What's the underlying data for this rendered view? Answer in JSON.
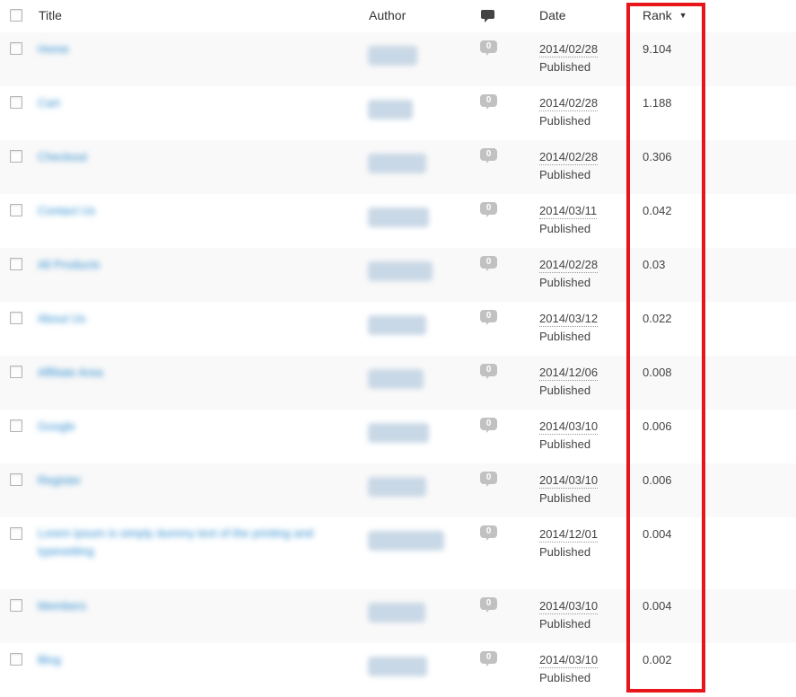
{
  "header": {
    "title_label": "Title",
    "author_label": "Author",
    "comments_icon": "comment-icon",
    "date_label": "Date",
    "rank_label": "Rank",
    "rank_sort_indicator": "▼"
  },
  "highlight_color": "#e8151b",
  "rows": [
    {
      "title": "Home",
      "comments": "0",
      "date": "2014/02/28",
      "status": "Published",
      "rank": "9.104"
    },
    {
      "title": "Cart",
      "comments": "0",
      "date": "2014/02/28",
      "status": "Published",
      "rank": "1.188"
    },
    {
      "title": "Checkout",
      "comments": "0",
      "date": "2014/02/28",
      "status": "Published",
      "rank": "0.306"
    },
    {
      "title": "Contact Us",
      "comments": "0",
      "date": "2014/03/11",
      "status": "Published",
      "rank": "0.042"
    },
    {
      "title": "All Products",
      "comments": "0",
      "date": "2014/02/28",
      "status": "Published",
      "rank": "0.03"
    },
    {
      "title": "About Us",
      "comments": "0",
      "date": "2014/03/12",
      "status": "Published",
      "rank": "0.022"
    },
    {
      "title": "Affiliate Area",
      "comments": "0",
      "date": "2014/12/06",
      "status": "Published",
      "rank": "0.008"
    },
    {
      "title": "Google",
      "comments": "0",
      "date": "2014/03/10",
      "status": "Published",
      "rank": "0.006"
    },
    {
      "title": "Register",
      "comments": "0",
      "date": "2014/03/10",
      "status": "Published",
      "rank": "0.006"
    },
    {
      "title": "Lorem ipsum is simply dummy text of the printing and typesetting",
      "comments": "0",
      "date": "2014/12/01",
      "status": "Published",
      "rank": "0.004"
    },
    {
      "title": "Members",
      "comments": "0",
      "date": "2014/03/10",
      "status": "Published",
      "rank": "0.004"
    },
    {
      "title": "Blog",
      "comments": "0",
      "date": "2014/03/10",
      "status": "Published",
      "rank": "0.002"
    }
  ]
}
